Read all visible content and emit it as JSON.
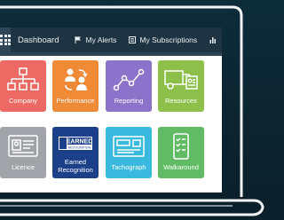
{
  "nav": {
    "dashboard": "Dashboard",
    "alerts": "My Alerts",
    "subscriptions": "My Subscriptions"
  },
  "tiles": [
    {
      "label": "Company",
      "color": "#ec6a63",
      "icon": "org-chart-icon"
    },
    {
      "label": "Performance",
      "color": "#ef8a37",
      "icon": "people-sync-icon"
    },
    {
      "label": "Reporting",
      "color": "#8b73c9",
      "icon": "line-graph-icon"
    },
    {
      "label": "Resources",
      "color": "#8cc04a",
      "icon": "truck-icon"
    },
    {
      "label": "Licence",
      "color": "#a0a4a8",
      "icon": "id-card-icon"
    },
    {
      "label": "Earned Recognition",
      "color": "#1c3f8a",
      "icon": "earned-recognition-logo"
    },
    {
      "label": "Tachograph",
      "color": "#38b9dd",
      "icon": "tachograph-card-icon"
    },
    {
      "label": "Walkaround",
      "color": "#61bb65",
      "icon": "phone-checklist-icon"
    }
  ],
  "earned_logo_text": {
    "line1": "EARNED",
    "line2": "RECOGNITION"
  },
  "colors": {
    "frame": "#ffffff",
    "background": "#0c2734",
    "topbar": "#1f3442"
  }
}
